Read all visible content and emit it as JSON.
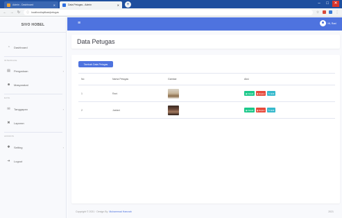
{
  "browser": {
    "tabs": [
      {
        "label": "Admin - Dashboard",
        "active": false
      },
      {
        "label": "Data Petugas - Admin",
        "active": true
      }
    ],
    "url": "localhost/aplikasi/petugas",
    "new_tab_glyph": "+",
    "back_glyph": "←",
    "forward_glyph": "→",
    "reload_glyph": "↻",
    "window_controls": [
      "–",
      "□",
      "✕"
    ]
  },
  "sidebar": {
    "brand": "SIVO HOBEL",
    "items": [
      {
        "label": "Dashboard",
        "icon": "gauge-icon"
      },
      {
        "label": "Pengaduan",
        "icon": "folder-icon",
        "has_children": true
      },
      {
        "label": "Masyarakat",
        "icon": "users-icon"
      },
      {
        "label": "Tanggapan",
        "icon": "comments-icon",
        "has_children": true
      },
      {
        "label": "Laporan",
        "icon": "print-icon"
      },
      {
        "label": "Setting",
        "icon": "cog-icon",
        "has_children": true
      },
      {
        "label": "Logout",
        "icon": "logout-icon"
      }
    ],
    "headings": [
      "INTERFACE",
      "DATA",
      "ADDONS"
    ]
  },
  "header": {
    "menu_glyph": "≡",
    "user_name": "Hi, Rani"
  },
  "main": {
    "page_title": "Data Petugas",
    "add_button": "Tambah Data Petugas",
    "columns": [
      "No",
      "Nama Petugas",
      "Gambar",
      "Aksi"
    ],
    "rows": [
      {
        "no": "1",
        "nama": "Rani"
      },
      {
        "no": "2",
        "nama": "Jaelani"
      }
    ],
    "actions": {
      "detail": "Detail",
      "hapus": "Hapus",
      "edit": "Edit"
    }
  },
  "footer": {
    "text": "Copyright © 2021 · Design By",
    "link": "Muhammad Hamzah",
    "right": "2021"
  },
  "colors": {
    "primary": "#4e73df",
    "success": "#1cc88a",
    "danger": "#e74a3b",
    "info": "#36b9cc"
  }
}
